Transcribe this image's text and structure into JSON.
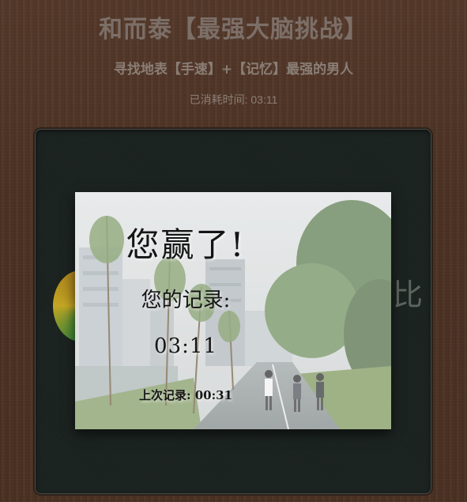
{
  "header": {
    "title": "和而泰【最强大脑挑战】",
    "subtitle": "寻找地表【手速】+【记忆】最强的男人",
    "elapsed": "已消耗时间: 03:11"
  },
  "board": {
    "partial_text": "比"
  },
  "result": {
    "win_title": "您赢了!",
    "record_label": "您的记录:",
    "record_time": "03:11",
    "last_record": "上次记录: 00:31"
  },
  "colors": {
    "background": "#4c3224",
    "board": "#1b2320",
    "title_text": "#7c6f68",
    "win_text": "#151515"
  },
  "icons": {
    "background_photo": "park-path-photo",
    "partial_tile": "colorful-circle-icon"
  }
}
